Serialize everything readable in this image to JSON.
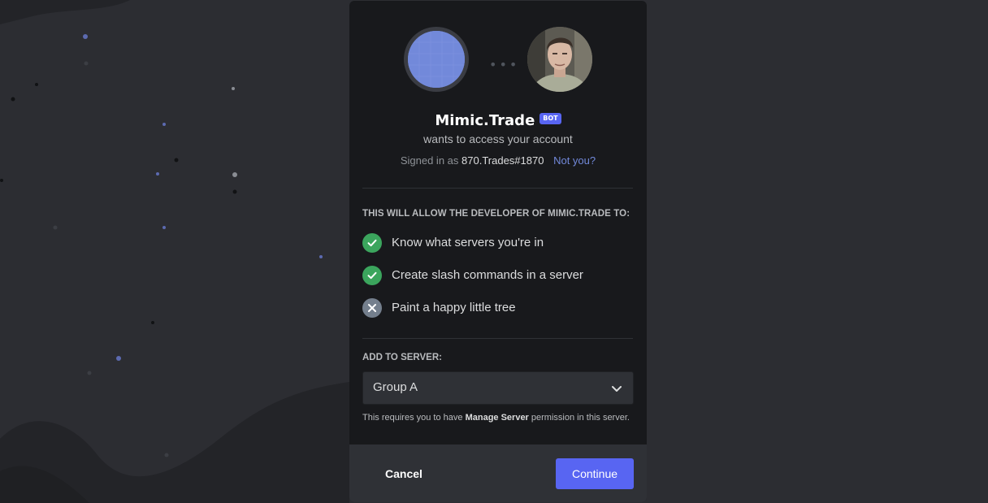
{
  "app": {
    "name": "Mimic.Trade",
    "bot_tag": "BOT",
    "subtitle": "wants to access your account"
  },
  "account": {
    "signed_in_prefix": "Signed in as",
    "username": "870.Trades#1870",
    "not_you": "Not you?"
  },
  "permissions": {
    "heading": "THIS WILL ALLOW THE DEVELOPER OF MIMIC.TRADE TO:",
    "items": [
      {
        "label": "Know what servers you're in",
        "granted": true
      },
      {
        "label": "Create slash commands in a server",
        "granted": true
      },
      {
        "label": "Paint a happy little tree",
        "granted": false
      }
    ]
  },
  "server": {
    "heading": "ADD TO SERVER:",
    "selected": "Group A",
    "requires_prefix": "This requires you to have",
    "requires_perm": "Manage Server",
    "requires_suffix": "permission in this server."
  },
  "footer": {
    "cancel_label": "Cancel",
    "continue_label": "Continue"
  },
  "colors": {
    "brand": "#5865f2",
    "success": "#3ba55d",
    "denied": "#747f8d",
    "link": "#7289da"
  }
}
